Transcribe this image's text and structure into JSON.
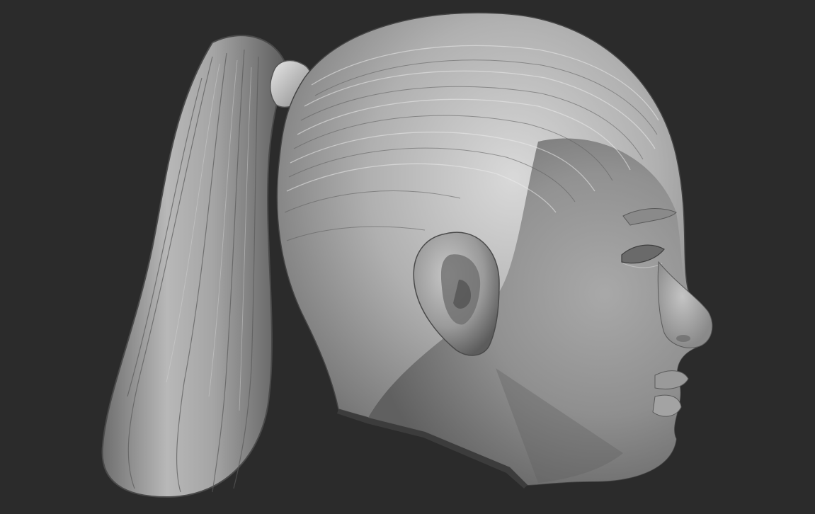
{
  "scene": {
    "subject": "sculpted-head-profile",
    "background_color": "#2b2b2b",
    "material_color": "#a9a9a9",
    "highlight_color": "#e6e6e6",
    "shadow_color": "#3a3a3a"
  }
}
